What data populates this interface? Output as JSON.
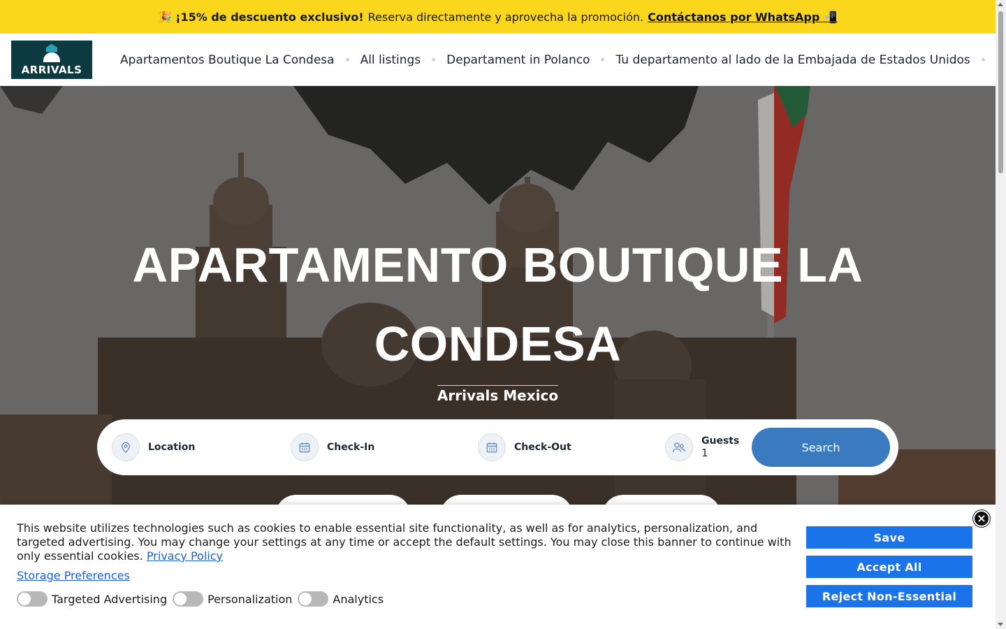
{
  "promo": {
    "emoji_left": "🎉",
    "bold": "¡15% de descuento exclusivo!",
    "text": "Reserva directamente y aprovecha la promoción.",
    "link": "Contáctanos por WhatsApp",
    "emoji_right": "📲",
    "bg_color": "#fad61c"
  },
  "header": {
    "logo_text": "ARRIVALS",
    "nav": [
      {
        "label": "Apartamentos Boutique La Condesa"
      },
      {
        "label": "All listings"
      },
      {
        "label": "Departament in Polanco"
      },
      {
        "label": "Tu departamento al lado de la Embajada de Estados Unidos"
      }
    ],
    "language_icon": "us-flag-icon"
  },
  "hero": {
    "title": "APARTAMENTO BOUTIQUE LA CONDESA",
    "subtitle": "Arrivals Mexico"
  },
  "search": {
    "location_label": "Location",
    "checkin_label": "Check-In",
    "checkout_label": "Check-Out",
    "guests_label": "Guests",
    "guests_value": "1",
    "button": "Search",
    "button_color": "#3a7bbf",
    "icons": [
      "map-pin-icon",
      "calendar-icon",
      "calendar-icon",
      "users-icon"
    ]
  },
  "cookie": {
    "text": "This website utilizes technologies such as cookies to enable essential site functionality, as well as for analytics, personalization, and targeted advertising. You may change your settings at any time or accept the default settings. You may close this banner to continue with only essential cookies.",
    "privacy_link": "Privacy Policy",
    "storage_link": "Storage Preferences",
    "toggles": [
      {
        "label": "Targeted Advertising"
      },
      {
        "label": "Personalization"
      },
      {
        "label": "Analytics"
      }
    ],
    "buttons": {
      "save": "Save",
      "accept": "Accept All",
      "reject": "Reject Non-Essential"
    },
    "close": "×",
    "button_color": "#1a73e8"
  }
}
